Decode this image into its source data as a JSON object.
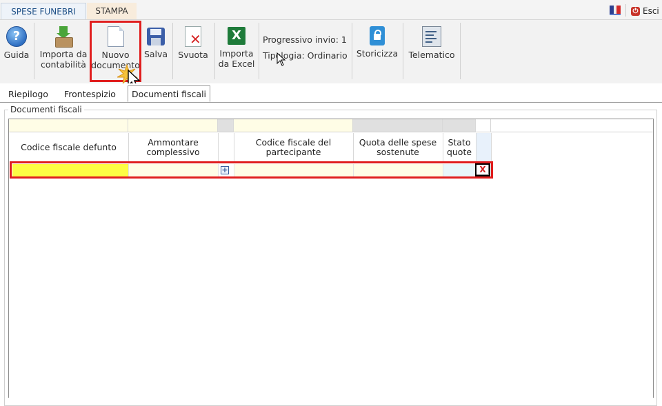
{
  "top_tabs": [
    {
      "label": "SPESE FUNEBRI",
      "active": true
    },
    {
      "label": "STAMPA",
      "active": false
    }
  ],
  "top_right": {
    "exit_label": "Esci"
  },
  "toolbar": {
    "guida": "Guida",
    "importa_contabilita": [
      "Importa da",
      "contabilità"
    ],
    "nuovo_documento": [
      "Nuovo",
      "documento"
    ],
    "salva": "Salva",
    "svuota": "Svuota",
    "importa_excel": [
      "Importa",
      "da Excel"
    ],
    "progressivo_invio": "Progressivo invio: 1",
    "tipologia": "Tipologia: Ordinario",
    "storicizza": "Storicizza",
    "telematico": "Telematico"
  },
  "sub_tabs": [
    {
      "label": "Riepilogo",
      "active": false
    },
    {
      "label": "Frontespizio",
      "active": false
    },
    {
      "label": "Documenti fiscali",
      "active": true
    }
  ],
  "group_title": "Documenti fiscali",
  "grid": {
    "columns": [
      "Codice fiscale defunto",
      "Ammontare complessivo",
      "",
      "Codice fiscale del partecipante",
      "Quota delle spese sostenute",
      "Stato quote"
    ],
    "row_values": [
      "",
      "",
      "",
      "",
      "",
      ""
    ],
    "delete_label": "X"
  },
  "colors": {
    "highlight_red": "#e01e1e",
    "row_yellow": "#fdfd44",
    "row_cream": "#fffde6",
    "stato_cell": "#e8f7fb",
    "header_gray": "#e0e0e0"
  }
}
